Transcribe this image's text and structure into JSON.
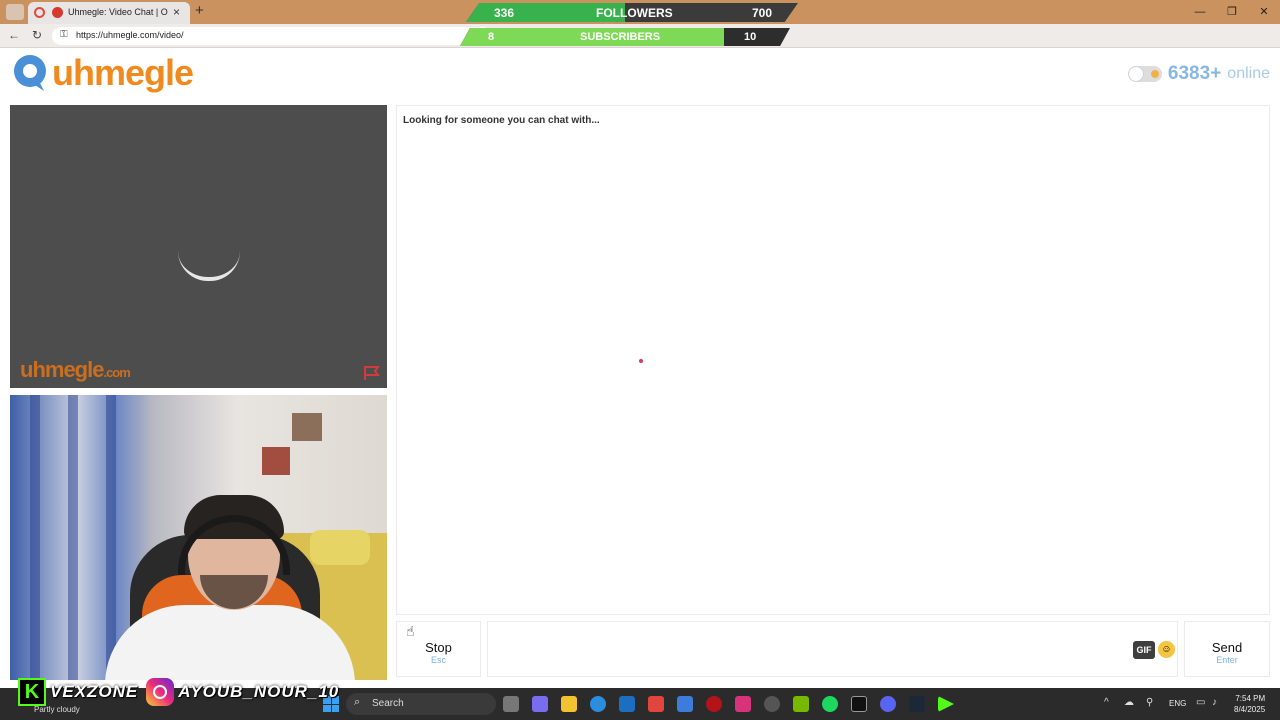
{
  "browser": {
    "tab_title": "Uhmegle: Video Chat | Omegle",
    "url": "https://uhmegle.com/video/",
    "window_controls": [
      "—",
      "❐",
      "✕"
    ]
  },
  "stream_overlay": {
    "followers": {
      "label": "FOLLOWERS",
      "current": "336",
      "goal": "700",
      "progress": 0.48
    },
    "subscribers": {
      "label": "SUBSCRIBERS",
      "current": "8",
      "goal": "10",
      "progress": 0.8
    },
    "kick_handle": "VEXZONE",
    "instagram_handle": "AYOUB_NOUR_10"
  },
  "site": {
    "logo_text": "uhmegle",
    "online_count": "6383+",
    "online_label": "online",
    "watermark": "uhmegle",
    "watermark_suffix": ".com"
  },
  "chat": {
    "status": "Looking for someone you can chat with...",
    "stop_label": "Stop",
    "stop_hint": "Esc",
    "send_label": "Send",
    "send_hint": "Enter",
    "gif_label": "GIF",
    "input_value": ""
  },
  "taskbar": {
    "weather": "Partly cloudy",
    "search_placeholder": "Search",
    "language": "ENG",
    "time": "7:54 PM",
    "date": "8/4/2025"
  },
  "colors": {
    "accent_orange": "#f08a1e",
    "online_blue": "#88b8e0",
    "followers_green": "#37b24d",
    "subs_green": "#7ed957"
  }
}
